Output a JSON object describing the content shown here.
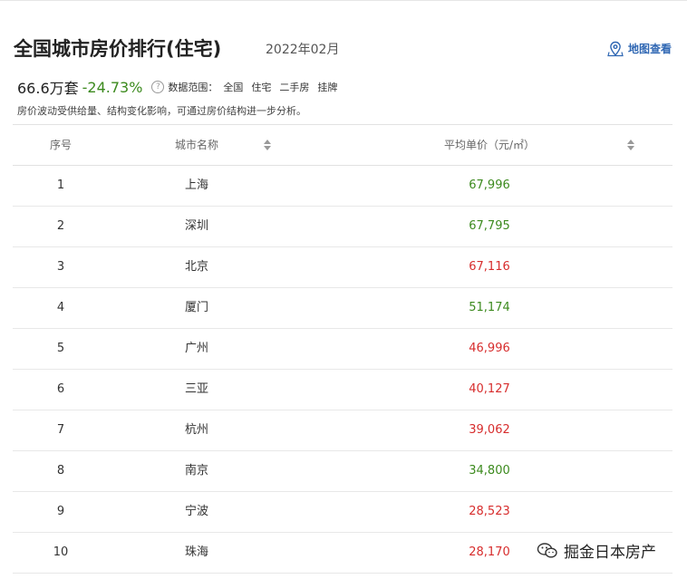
{
  "header": {
    "title": "全国城市房价排行(住宅)",
    "period": "2022年02月",
    "map_link": "地图查看"
  },
  "summary": {
    "total": "66.6万套",
    "change": "-24.73%",
    "help_icon": "?",
    "scope_label": "数据范围：",
    "scope_items": [
      "全国",
      "住宅",
      "二手房",
      "挂牌"
    ],
    "note": "房价波动受供给量、结构变化影响，可通过房价结构进一步分析。"
  },
  "table": {
    "columns": {
      "rank": "序号",
      "city": "城市名称",
      "price": "平均单价（元/㎡）"
    },
    "rows": [
      {
        "rank": "1",
        "city": "上海",
        "price": "67,996",
        "trend": "down"
      },
      {
        "rank": "2",
        "city": "深圳",
        "price": "67,795",
        "trend": "down"
      },
      {
        "rank": "3",
        "city": "北京",
        "price": "67,116",
        "trend": "up"
      },
      {
        "rank": "4",
        "city": "厦门",
        "price": "51,174",
        "trend": "down"
      },
      {
        "rank": "5",
        "city": "广州",
        "price": "46,996",
        "trend": "up"
      },
      {
        "rank": "6",
        "city": "三亚",
        "price": "40,127",
        "trend": "up"
      },
      {
        "rank": "7",
        "city": "杭州",
        "price": "39,062",
        "trend": "up"
      },
      {
        "rank": "8",
        "city": "南京",
        "price": "34,800",
        "trend": "down"
      },
      {
        "rank": "9",
        "city": "宁波",
        "price": "28,523",
        "trend": "up"
      },
      {
        "rank": "10",
        "city": "珠海",
        "price": "28,170",
        "trend": "up"
      }
    ]
  },
  "watermark": {
    "text": "掘金日本房产",
    "icon": "wechat-icon"
  },
  "colors": {
    "up": "#d72d2d",
    "down": "#3c8a1e",
    "link": "#2f67b3"
  }
}
